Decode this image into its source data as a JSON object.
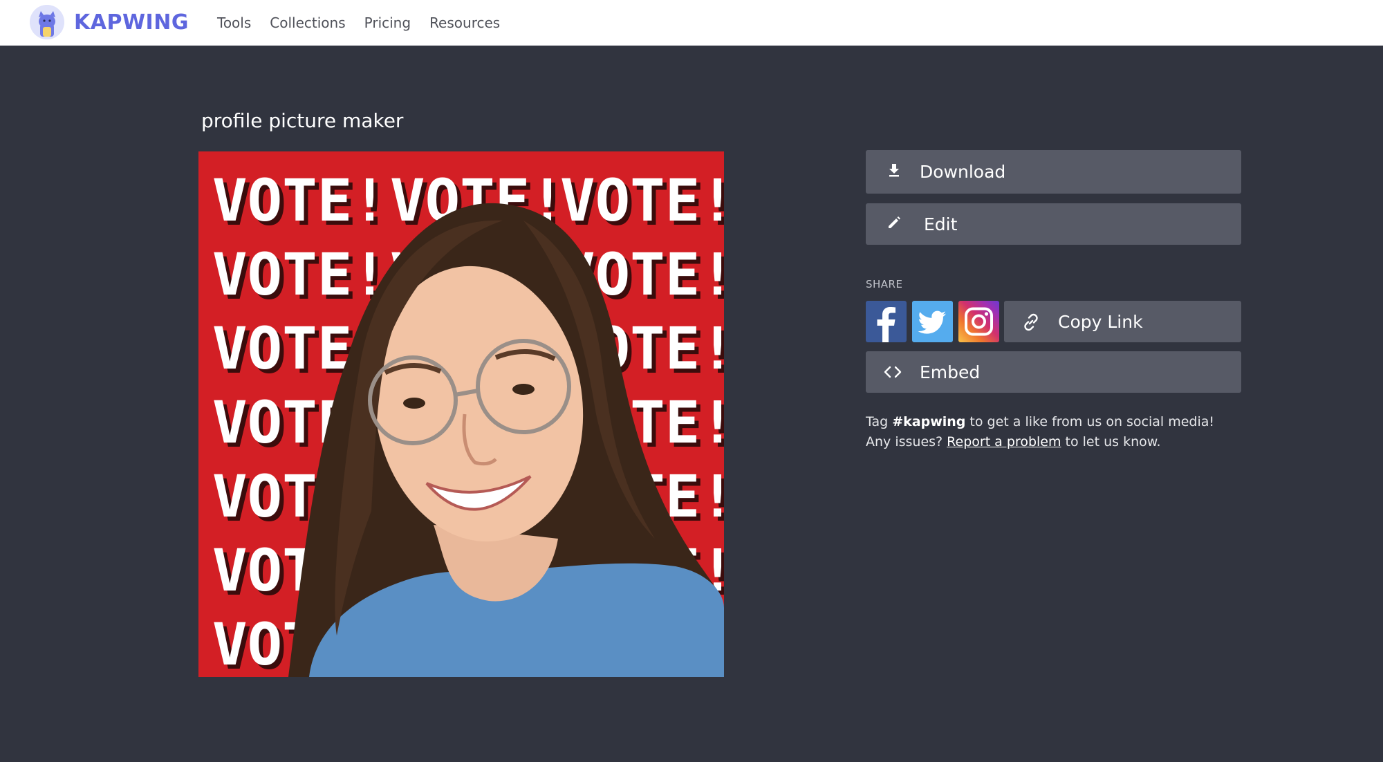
{
  "header": {
    "logo_text": "KAPWING",
    "nav": [
      "Tools",
      "Collections",
      "Pricing",
      "Resources"
    ]
  },
  "main": {
    "title": "profile picture maker",
    "preview": {
      "word": "VOTE!",
      "background_color": "#d31f25",
      "description_icon": "person-photo"
    }
  },
  "sidebar": {
    "download_label": "Download",
    "edit_label": "Edit",
    "share_label": "SHARE",
    "copy_link_label": "Copy Link",
    "embed_label": "Embed",
    "help": {
      "prefix": "Tag ",
      "tag": "#kapwing",
      "middle": " to get a like from us on social media! Any issues? ",
      "link": "Report a problem",
      "suffix": " to let us know."
    }
  },
  "colors": {
    "page_bg": "#31343f",
    "button_bg": "#575a66",
    "brand": "#5e66de",
    "facebook": "#3b5998",
    "twitter": "#55acee"
  }
}
